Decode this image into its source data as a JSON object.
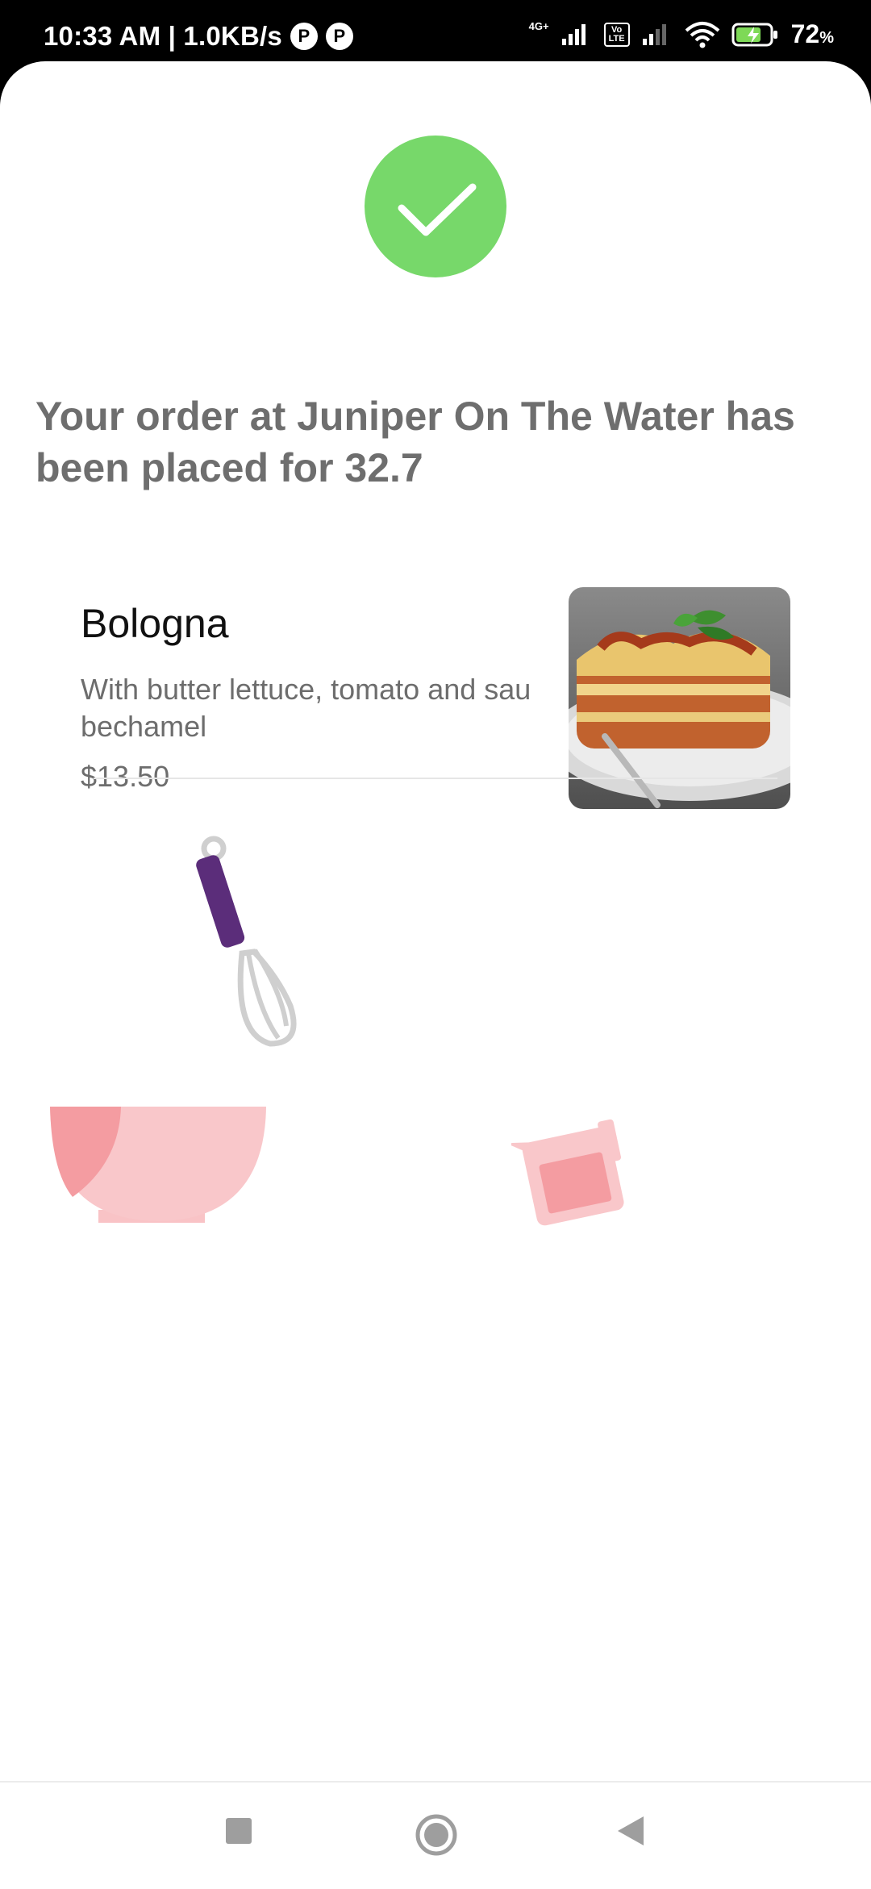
{
  "status_bar": {
    "time_speed": "10:33 AM | 1.0KB/s",
    "badge1": "P",
    "badge2": "P",
    "network_type": "4G+",
    "volte": "Vo LTE",
    "battery_percent": "72",
    "battery_unit": "%"
  },
  "order": {
    "status_icon": "check-icon",
    "accent_color": "#77d86a",
    "headline": "Your order at Juniper On The Water has been placed for 32.7",
    "item": {
      "name": "Bologna",
      "description_line1": "With butter lettuce, tomato and sau",
      "description_line2": "bechamel",
      "price": "$13.50",
      "image": "lasagna-photo"
    }
  },
  "illustrations": [
    "whisk-icon",
    "mixing-bowl-icon",
    "measuring-cup-icon"
  ],
  "nav": {
    "recents": "square-icon",
    "home": "circle-icon",
    "back": "triangle-back-icon"
  }
}
